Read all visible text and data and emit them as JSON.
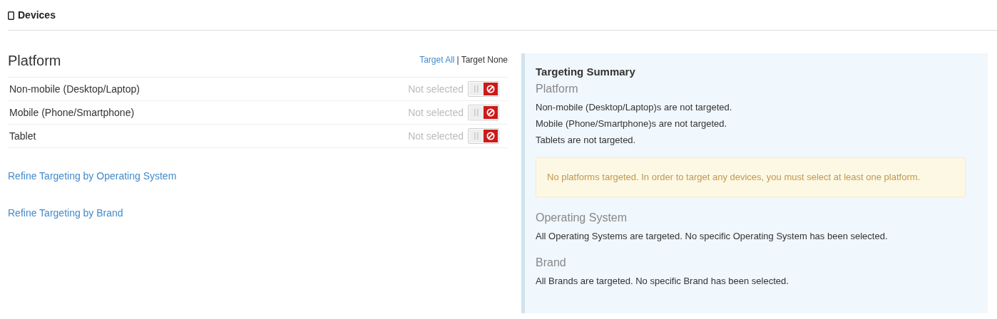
{
  "header": {
    "title": "Devices"
  },
  "platform": {
    "title": "Platform",
    "target_all": "Target All",
    "separator": "|",
    "target_none": "Target None",
    "items": [
      {
        "label": "Non-mobile (Desktop/Laptop)",
        "status": "Not selected",
        "selected": false
      },
      {
        "label": "Mobile (Phone/Smartphone)",
        "status": "Not selected",
        "selected": false
      },
      {
        "label": "Tablet",
        "status": "Not selected",
        "selected": false
      }
    ]
  },
  "links": [
    "Refine Targeting by Operating System",
    "Refine Targeting by Brand"
  ],
  "summary": {
    "title": "Targeting Summary",
    "sections": [
      {
        "heading": "Platform",
        "lines": [
          "Non-mobile (Desktop/Laptop)s are not targeted.",
          "Mobile (Phone/Smartphone)s are not targeted.",
          "Tablets are not targeted."
        ],
        "warning": "No platforms targeted. In order to target any devices, you must select at least one platform."
      },
      {
        "heading": "Operating System",
        "lines": [
          "All Operating Systems are targeted. No specific Operating System has been selected."
        ]
      },
      {
        "heading": "Brand",
        "lines": [
          "All Brands are targeted. No specific Brand has been selected."
        ]
      }
    ]
  }
}
